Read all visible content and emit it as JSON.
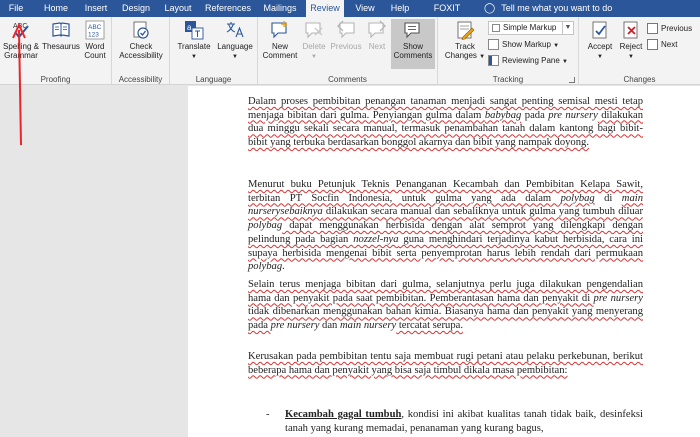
{
  "tabs": [
    {
      "label": "File"
    },
    {
      "label": "Home"
    },
    {
      "label": "Insert"
    },
    {
      "label": "Design"
    },
    {
      "label": "Layout"
    },
    {
      "label": "References"
    },
    {
      "label": "Mailings"
    },
    {
      "label": "Review",
      "active": true
    },
    {
      "label": "View"
    },
    {
      "label": "Help"
    },
    {
      "label": "FOXIT PDF"
    }
  ],
  "tell_me": "Tell me what you want to do",
  "ribbon": {
    "proofing": {
      "label": "Proofing",
      "spelling": "Spelling &",
      "grammar": "Grammar",
      "thesaurus": "Thesaurus",
      "word_count_1": "Word",
      "word_count_2": "Count",
      "abc_glyph": "ABC",
      "abc_num": "123"
    },
    "accessibility": {
      "label": "Accessibility",
      "check_1": "Check",
      "check_2": "Accessibility"
    },
    "language": {
      "label": "Language",
      "translate": "Translate",
      "language": "Language"
    },
    "comments": {
      "label": "Comments",
      "new_1": "New",
      "new_2": "Comment",
      "delete": "Delete",
      "previous": "Previous",
      "next": "Next",
      "show_1": "Show",
      "show_2": "Comments"
    },
    "tracking": {
      "label": "Tracking",
      "track_1": "Track",
      "track_2": "Changes",
      "simple_markup": "Simple Markup",
      "show_markup": "Show Markup",
      "reviewing_pane": "Reviewing Pane"
    },
    "changes": {
      "label": "Changes",
      "accept": "Accept",
      "reject": "Reject",
      "previous": "Previous",
      "next": "Next"
    }
  },
  "document": {
    "p1": [
      {
        "t": "Dalam proses pembibitan penangan tanaman menjadi sangat penting semisal mesti tetap menjaga bibitan dari gulma. Penyiangan gulma dalam ",
        "u": true
      },
      {
        "t": "babybag",
        "i": true,
        "u": true
      },
      {
        "t": " pada ",
        "u": false
      },
      {
        "t": "pre nursery",
        "i": true
      },
      {
        "t": " dilakukan dua minggu sekali secara manual, termasuk penambahan tanah dalam kantong bagi bibit-bibit yang terbuka berdasarkan bonggol akarnya dan bibit yang nampak doyong.",
        "u": true
      }
    ],
    "p2": [
      {
        "t": "Menurut buku Petunjuk Teknis Penanganan Kecambah dan Pembibitan Kelapa Sawit, terbitan PT Socfin Indonesia, untuk gulma yang ada dalam ",
        "u": true
      },
      {
        "t": "polybag",
        "i": true,
        "u": true
      },
      {
        "t": " di ",
        "u": false
      },
      {
        "t": "main nurserysebaiknya",
        "i": true,
        "u": true
      },
      {
        "t": " dilakukan secara manual dan sebaliknya untuk gulma yang tumbuh diluar ",
        "u": true
      },
      {
        "t": "polybag",
        "i": true
      },
      {
        "t": " dapat menggunakan herbisida dengan alat semprot yang dilengkapi dengan pelindung pada bagian ",
        "u": true
      },
      {
        "t": "nozzel-nya",
        "i": true,
        "u": true
      },
      {
        "t": " guna menghindari terjadinya kabut herbisida, cara ini supaya herbisida mengenai bibit serta penyemprotan harus lebih rendah dari permukaan ",
        "u": true
      },
      {
        "t": "polybag",
        "i": true
      },
      {
        "t": ".",
        "u": false
      }
    ],
    "p3": [
      {
        "t": "Selain terus menjaga bibitan dari gulma, selanjutnya perlu juga dilakukan pengendalian hama dan penyakit pada saat pembibitan. Pemberantasan hama dan penyakit di ",
        "u": true
      },
      {
        "t": "pre nursery",
        "i": true
      },
      {
        "t": " tidak dibenarkan menggunakan bahan kimia. Biasanya hama dan penyakit yang menyerang pada ",
        "u": true
      },
      {
        "t": "pre nursery",
        "i": true
      },
      {
        "t": " dan ",
        "u": false
      },
      {
        "t": "main nursery",
        "i": true
      },
      {
        "t": " tercatat serupa.",
        "u": true
      }
    ],
    "p4": [
      {
        "t": "Kerusakan pada pembibitan tentu saja membuat rugi petani atau pelaku perkebunan, berikut beberapa hama dan penyakit yang bisa saja timbul dikala masa pembibitan:",
        "u": true
      }
    ],
    "bullet_dash": "-",
    "bullet1_title": "Kecambah gagal tumbuh",
    "bullet1_text": ", kondisi ini akibat kualitas tanah tidak baik, desinfeksi tanah yang kurang memadai, penanaman yang kurang bagus,"
  }
}
